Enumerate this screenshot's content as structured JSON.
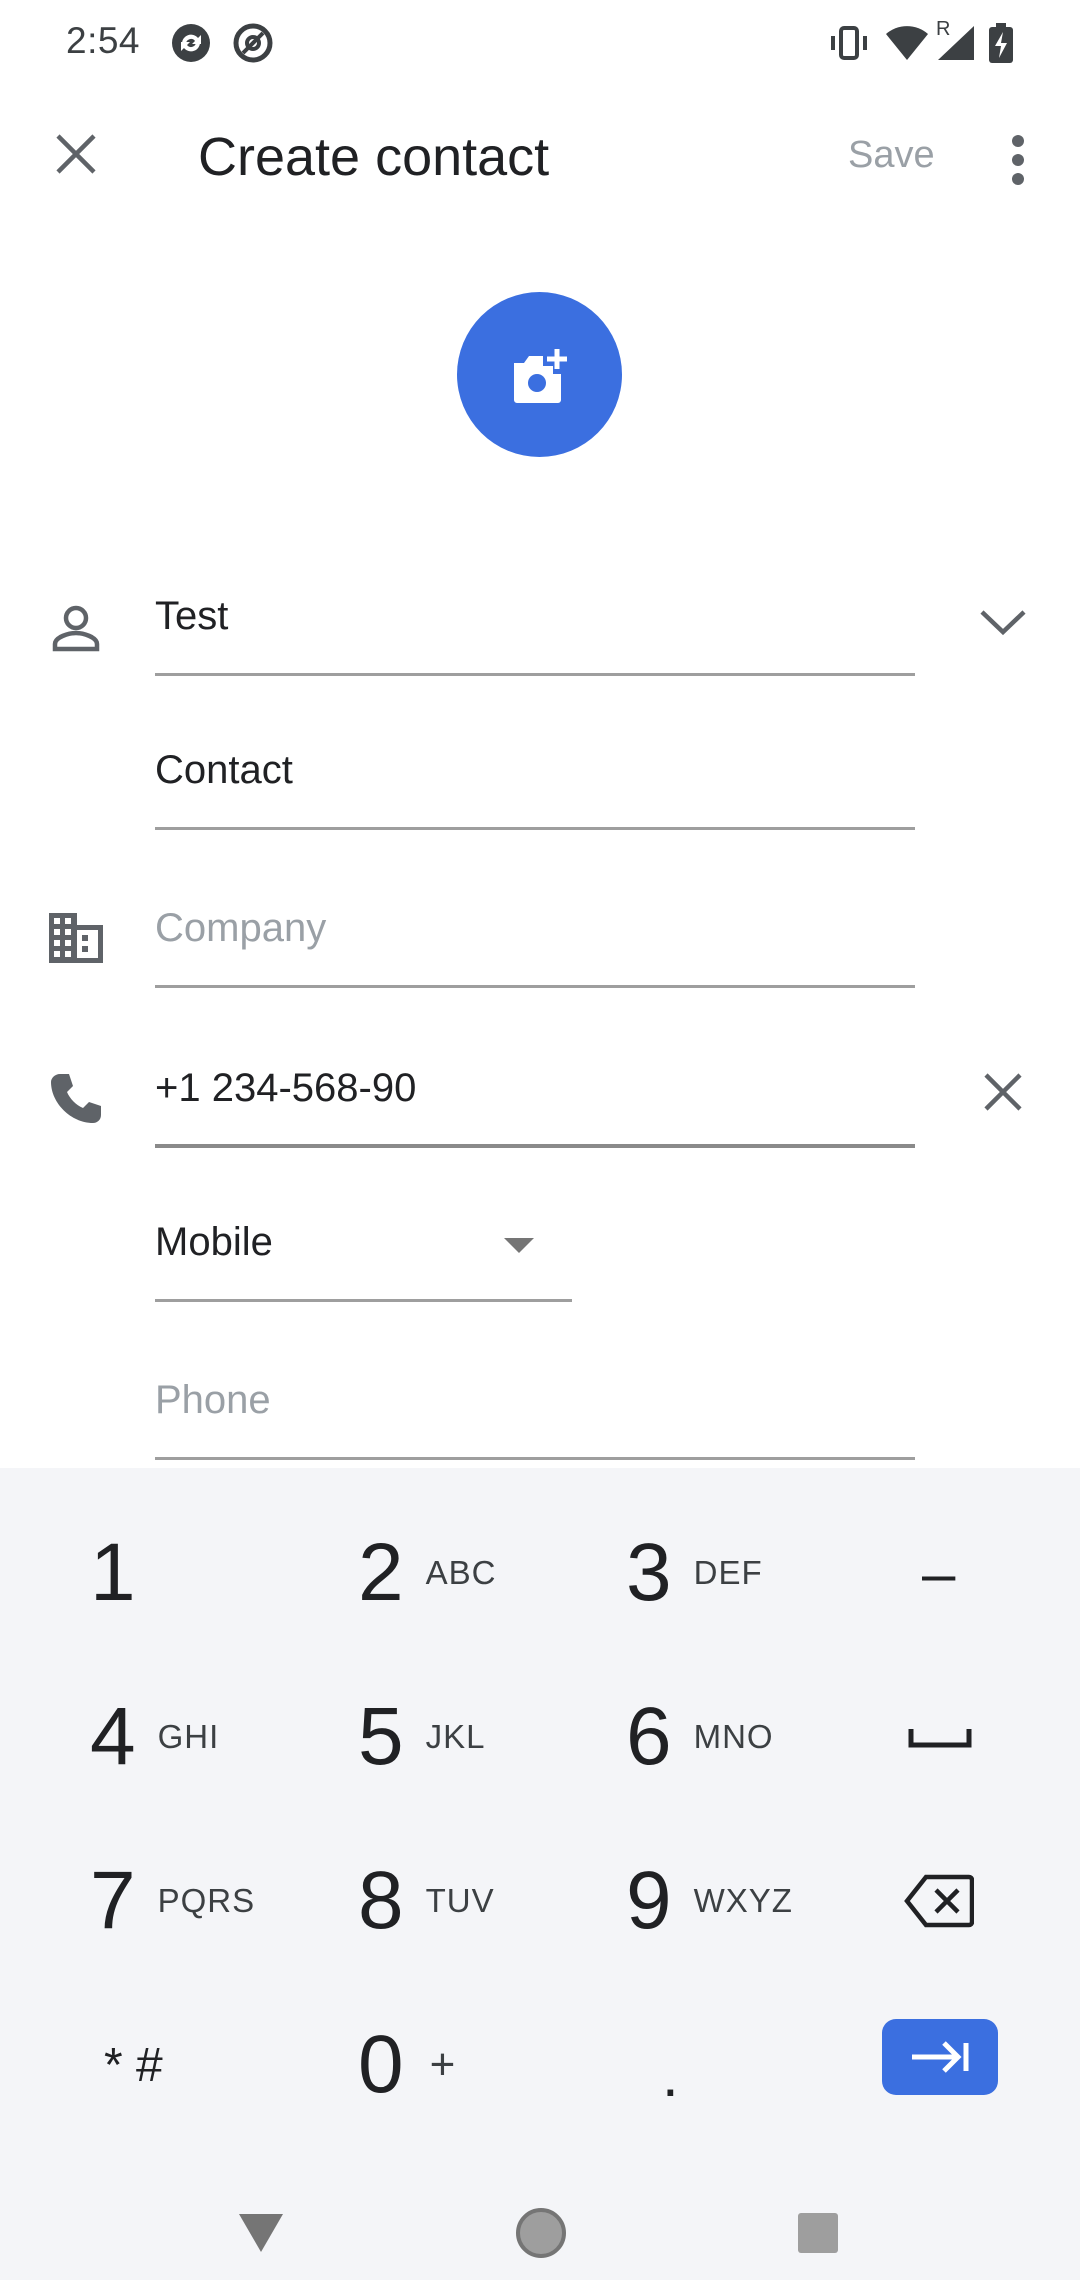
{
  "status_bar": {
    "time": "2:54",
    "roaming_indicator": "R",
    "left_icons": [
      "sync-app-icon",
      "at-sign-app-icon"
    ],
    "right_icons": [
      "vibrate-icon",
      "wifi-icon",
      "signal-icon",
      "battery-charging-icon"
    ]
  },
  "toolbar": {
    "title": "Create contact",
    "save_label": "Save"
  },
  "form": {
    "first_name": "Test",
    "last_name": "Contact",
    "company_placeholder": "Company",
    "phone_value": "+1 234-568-90",
    "phone_type": "Mobile",
    "phone_placeholder": "Phone"
  },
  "keypad": {
    "keys": [
      {
        "digit": "1",
        "letters": ""
      },
      {
        "digit": "2",
        "letters": "ABC"
      },
      {
        "digit": "3",
        "letters": "DEF"
      },
      {
        "digit": "4",
        "letters": "GHI"
      },
      {
        "digit": "5",
        "letters": "JKL"
      },
      {
        "digit": "6",
        "letters": "MNO"
      },
      {
        "digit": "7",
        "letters": "PQRS"
      },
      {
        "digit": "8",
        "letters": "TUV"
      },
      {
        "digit": "9",
        "letters": "WXYZ"
      },
      {
        "digit": "0",
        "letters": "+"
      }
    ],
    "symbols_label": "* #",
    "dash_label": "–",
    "period_label": ".",
    "accent_color": "#3b6fe0"
  },
  "colors": {
    "accent": "#3b6fe0",
    "keypad_bg": "#f4f5f8",
    "placeholder": "#9aa0a6"
  }
}
